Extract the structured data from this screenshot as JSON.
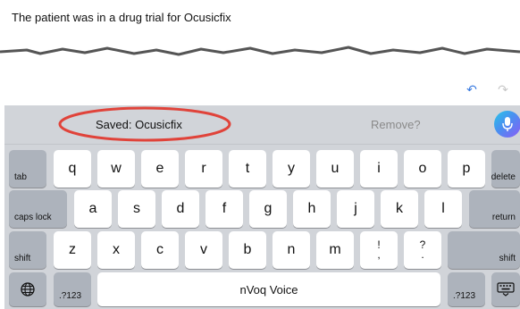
{
  "document": {
    "text": "The patient was in a drug trial for Ocusicfix"
  },
  "toolbar": {
    "undo_icon": "undo-icon",
    "redo_icon": "redo-icon"
  },
  "suggestions": {
    "saved": "Saved: Ocusicfix",
    "remove": "Remove?",
    "mic_icon": "microphone-icon",
    "highlight_color": "#e0433a"
  },
  "keyboard": {
    "row1": [
      "q",
      "w",
      "e",
      "r",
      "t",
      "y",
      "u",
      "i",
      "o",
      "p"
    ],
    "row2": [
      "a",
      "s",
      "d",
      "f",
      "g",
      "h",
      "j",
      "k",
      "l"
    ],
    "row3": [
      "z",
      "x",
      "c",
      "v",
      "b",
      "n",
      "m"
    ],
    "tab": "tab",
    "delete": "delete",
    "caps_lock": "caps lock",
    "return": "return",
    "shift_left": "shift",
    "shift_right": "shift",
    "excl_top": "!",
    "excl_bottom": ",",
    "question_top": "?",
    "question_bottom": ".",
    "numbers_left": ".?123",
    "numbers_right": ".?123",
    "space": "nVoq Voice",
    "globe_icon": "globe-icon",
    "keyboard_hide_icon": "keyboard-hide-icon"
  }
}
